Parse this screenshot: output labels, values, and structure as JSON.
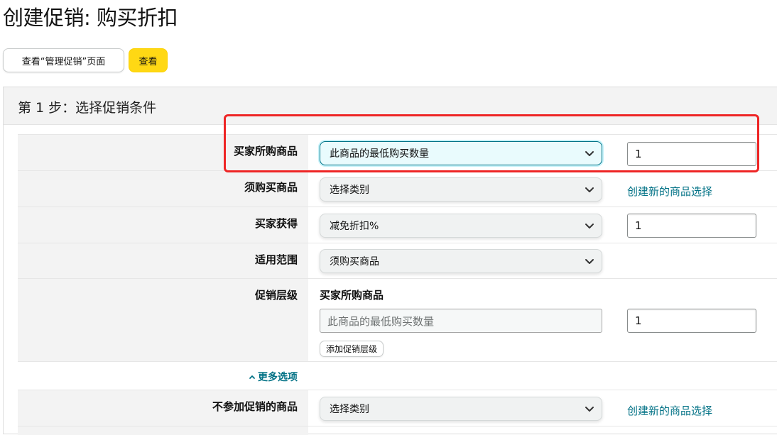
{
  "page": {
    "title": "创建促销: 购买折扣"
  },
  "top_buttons": {
    "view_manage_label": "查看“管理促销”页面",
    "view_label": "查看"
  },
  "step": {
    "title": "第 1 步：选择促销条件"
  },
  "rows": {
    "buyer_purchases": {
      "label": "买家所购商品",
      "select_value": "此商品的最低购买数量",
      "input_value": "1"
    },
    "required_items": {
      "label": "须购买商品",
      "select_value": "选择类别",
      "link": "创建新的商品选择"
    },
    "buyer_gets": {
      "label": "买家获得",
      "select_value": "减免折扣%",
      "input_value": "1"
    },
    "applies_to": {
      "label": "适用范围",
      "select_value": "须购买商品"
    },
    "tiers": {
      "label": "促销层级",
      "sub_heading": "买家所购商品",
      "field_value": "此商品的最低购买数量",
      "input_value": "1",
      "add_button": "添加促销层级"
    },
    "more_options": {
      "label": "更多选项",
      "icon": "chevron-up-icon"
    },
    "excluded_items": {
      "label": "不参加促销的商品",
      "select_value": "选择类别",
      "link": "创建新的商品选择"
    }
  },
  "colors": {
    "primary_button": "#ffd814",
    "link": "#007185",
    "highlight": "#ee2525"
  }
}
